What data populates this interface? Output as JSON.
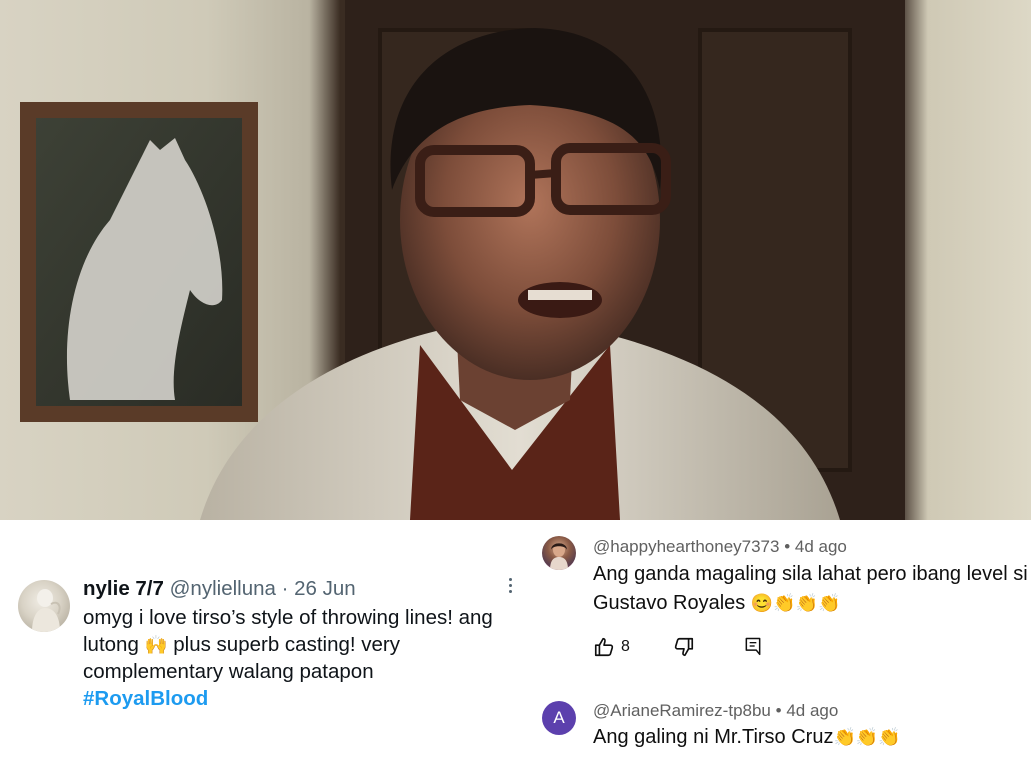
{
  "tweet": {
    "name": "nylie 7/7",
    "handle": "@nylielluna",
    "separator": "·",
    "date": "26 Jun",
    "lines": [
      "omyg i love tirso’s style of throwing lines! ang",
      "lutong",
      "plus superb casting! very",
      "complementary walang patapon"
    ],
    "emoji": "🙌",
    "hashtag": "#RoyalBlood",
    "more_icon": "more-horizontal-icon"
  },
  "comments": [
    {
      "author": "@happyhearthoney7373",
      "time": "4d ago",
      "text_line1": "Ang ganda magaling sila lahat pero ibang level si",
      "text_line2": "Gustavo Royales",
      "emojis": "😊👏👏👏",
      "likes": "8",
      "avatar_icon": "user-photo-avatar"
    },
    {
      "author": "@ArianeRamirez-tp8bu",
      "time": "4d ago",
      "text": "Ang galing ni Mr.Tirso Cruz",
      "emojis": "👏👏👏",
      "avatar_letter": "A",
      "avatar_color": "#5c40ad"
    }
  ],
  "comment_separator": "•",
  "colors": {
    "tweet_link": "#1d9bf0",
    "meta_gray": "#606060",
    "avatar_purple": "#5c40ad"
  }
}
